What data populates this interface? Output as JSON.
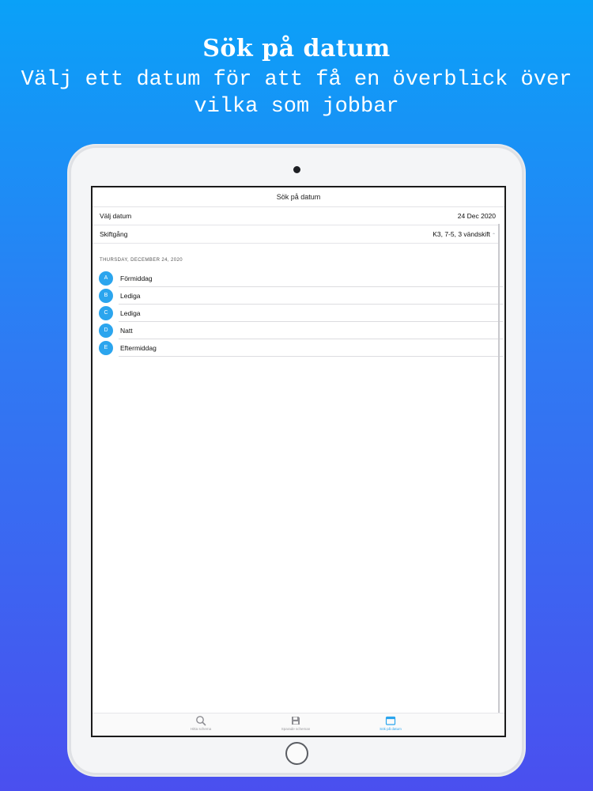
{
  "promo": {
    "title": "Sök på datum",
    "subtitle": "Välj ett datum för att få en överblick över vilka som jobbar"
  },
  "screen": {
    "nav_title": "Sök på datum",
    "date_row": {
      "label": "Välj datum",
      "value": "24 Dec 2020"
    },
    "shift_row": {
      "label": "Skiftgång",
      "value": "K3, 7-5, 3 vändskift"
    },
    "section_header": "THURSDAY, DECEMBER 24, 2020",
    "teams": [
      {
        "badge": "A",
        "name": "Förmiddag"
      },
      {
        "badge": "B",
        "name": "Lediga"
      },
      {
        "badge": "C",
        "name": "Lediga"
      },
      {
        "badge": "D",
        "name": "Natt"
      },
      {
        "badge": "E",
        "name": "Eftermiddag"
      }
    ],
    "tabs": [
      {
        "label": "Hitta schema",
        "icon": "search-icon",
        "active": false
      },
      {
        "label": "Sparade scheman",
        "icon": "save-icon",
        "active": false
      },
      {
        "label": "Sök på datum",
        "icon": "calendar-icon",
        "active": true
      }
    ]
  },
  "colors": {
    "accent": "#2ba5ee",
    "background_top": "#0aa1f8",
    "background_bottom": "#4a4fef"
  }
}
